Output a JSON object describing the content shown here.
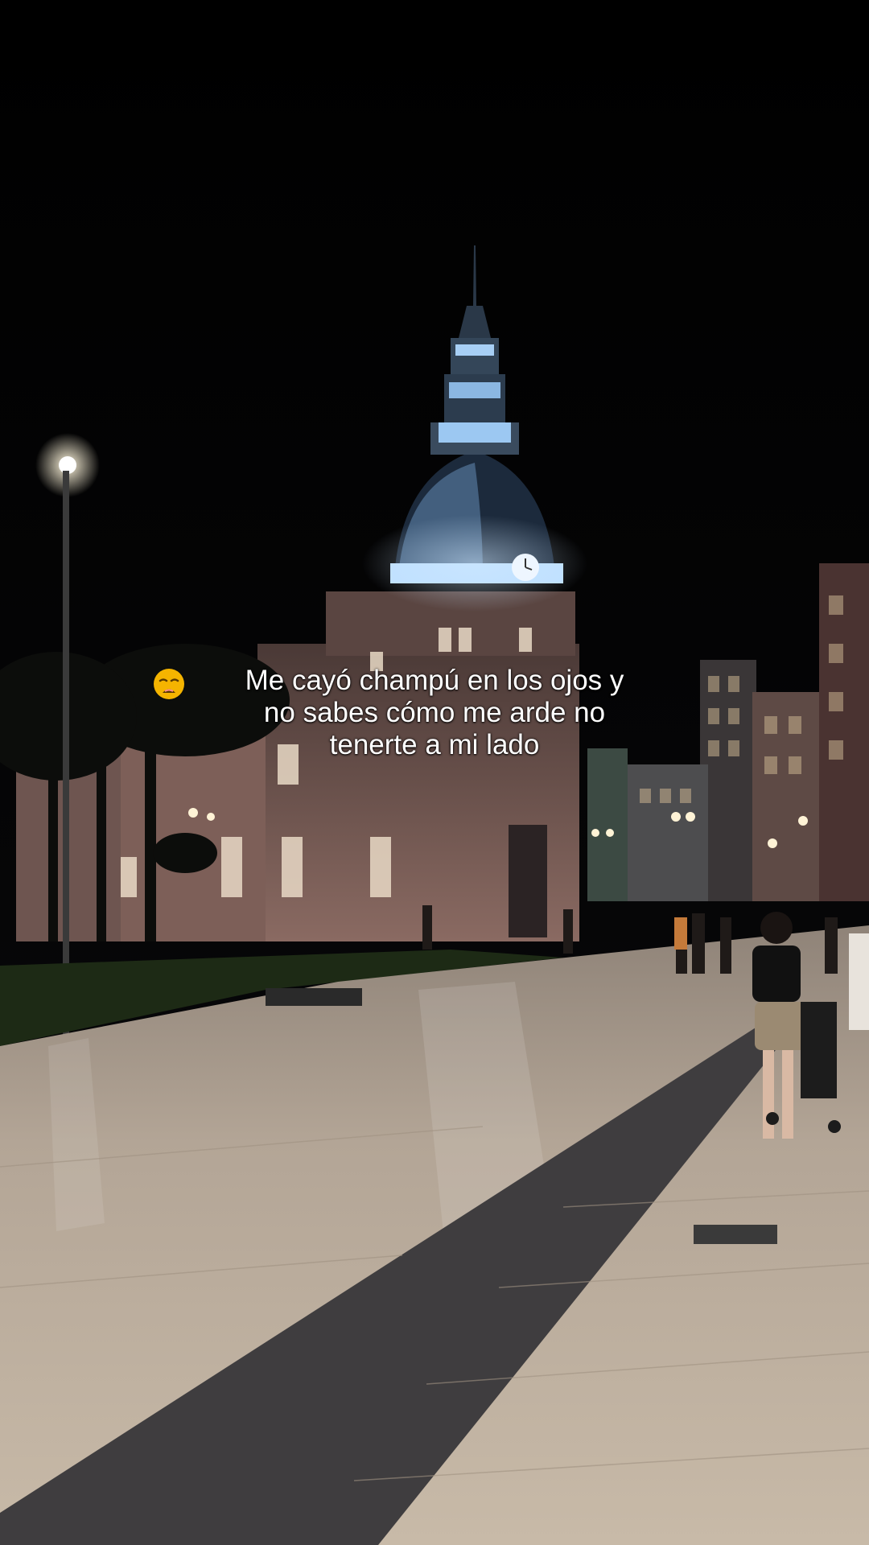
{
  "caption": {
    "line1": "Me cayó champú en los ojos y",
    "line2": "no sabes cómo me arde no",
    "line3": "tenerte a mi lado"
  },
  "emoji": {
    "icon": "weary-face-icon",
    "color": "#f5b400"
  },
  "colors": {
    "sky": "#000000",
    "building": "#6f5650",
    "dome_light": "#a9d6ff",
    "pavement": "#b9aa9a",
    "cobble": "#3f3d3f",
    "grass": "#1d2a15"
  }
}
